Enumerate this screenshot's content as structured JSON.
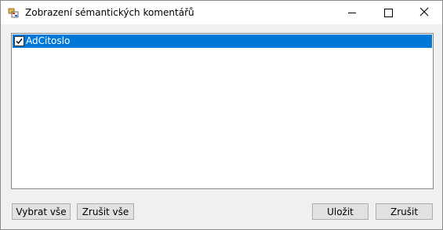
{
  "window": {
    "title": "Zobrazení sémantických komentářů",
    "icon": "dialog-app-icon"
  },
  "titlebar_buttons": {
    "minimize_icon": "minimize-icon",
    "maximize_icon": "maximize-icon",
    "close_icon": "close-icon"
  },
  "list": {
    "items": [
      {
        "label": "AdCitoslo",
        "checked": true,
        "selected": true
      }
    ]
  },
  "buttons": {
    "select_all": "Vybrat vše",
    "clear_all": "Zrušit vše",
    "save": "Uložit",
    "cancel": "Zrušit"
  },
  "colors": {
    "selection": "#0078d7",
    "dialog_bg": "#f0f0f0",
    "button_bg": "#e1e1e1"
  }
}
